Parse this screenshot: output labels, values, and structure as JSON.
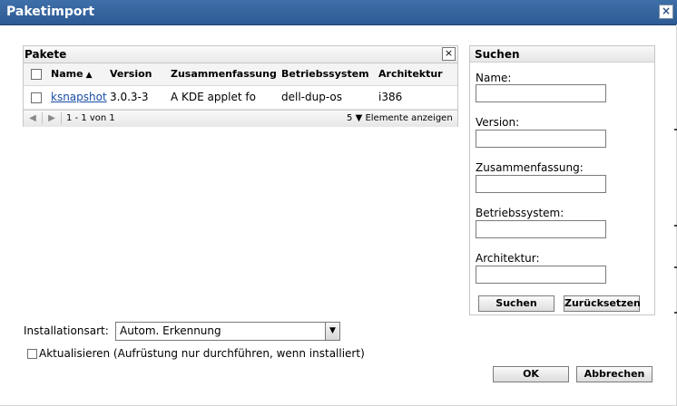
{
  "window": {
    "title": "Paketimport"
  },
  "packages": {
    "title": "Pakete",
    "columns": [
      "Name",
      "Version",
      "Zusammenfassung",
      "Betriebssystem",
      "Architektur"
    ],
    "rows": [
      {
        "name": "ksnapshot",
        "version": "3.0.3-3",
        "summary": "A KDE applet fo",
        "os": "dell-dup-os",
        "arch": "i386"
      }
    ],
    "pager": {
      "range": "1 - 1 von 1",
      "per_page": "5",
      "per_page_label": "Elemente anzeigen"
    }
  },
  "search": {
    "title": "Suchen",
    "fields": [
      {
        "label": "Name:",
        "value": ""
      },
      {
        "label": "Version:",
        "value": ""
      },
      {
        "label": "Zusammenfassung:",
        "value": ""
      },
      {
        "label": "Betriebssystem:",
        "value": ""
      },
      {
        "label": "Architektur:",
        "value": ""
      }
    ],
    "search_button": "Suchen",
    "reset_button": "Zurücksetzen"
  },
  "install": {
    "label": "Installationsart:",
    "selected": "Autom. Erkennung",
    "update_label": "Aktualisieren (Aufrüstung nur durchführen, wenn installiert)",
    "update_checked": false
  },
  "buttons": {
    "ok": "OK",
    "cancel": "Abbrechen"
  },
  "icons": {
    "close": "close-icon",
    "sort": "sort-ascending-icon",
    "first": "pager-previous-icon",
    "next": "pager-next-icon",
    "dropdown": "chevron-down-icon"
  },
  "colors": {
    "titlebar": "#335f99",
    "link": "#1a4ea6"
  }
}
